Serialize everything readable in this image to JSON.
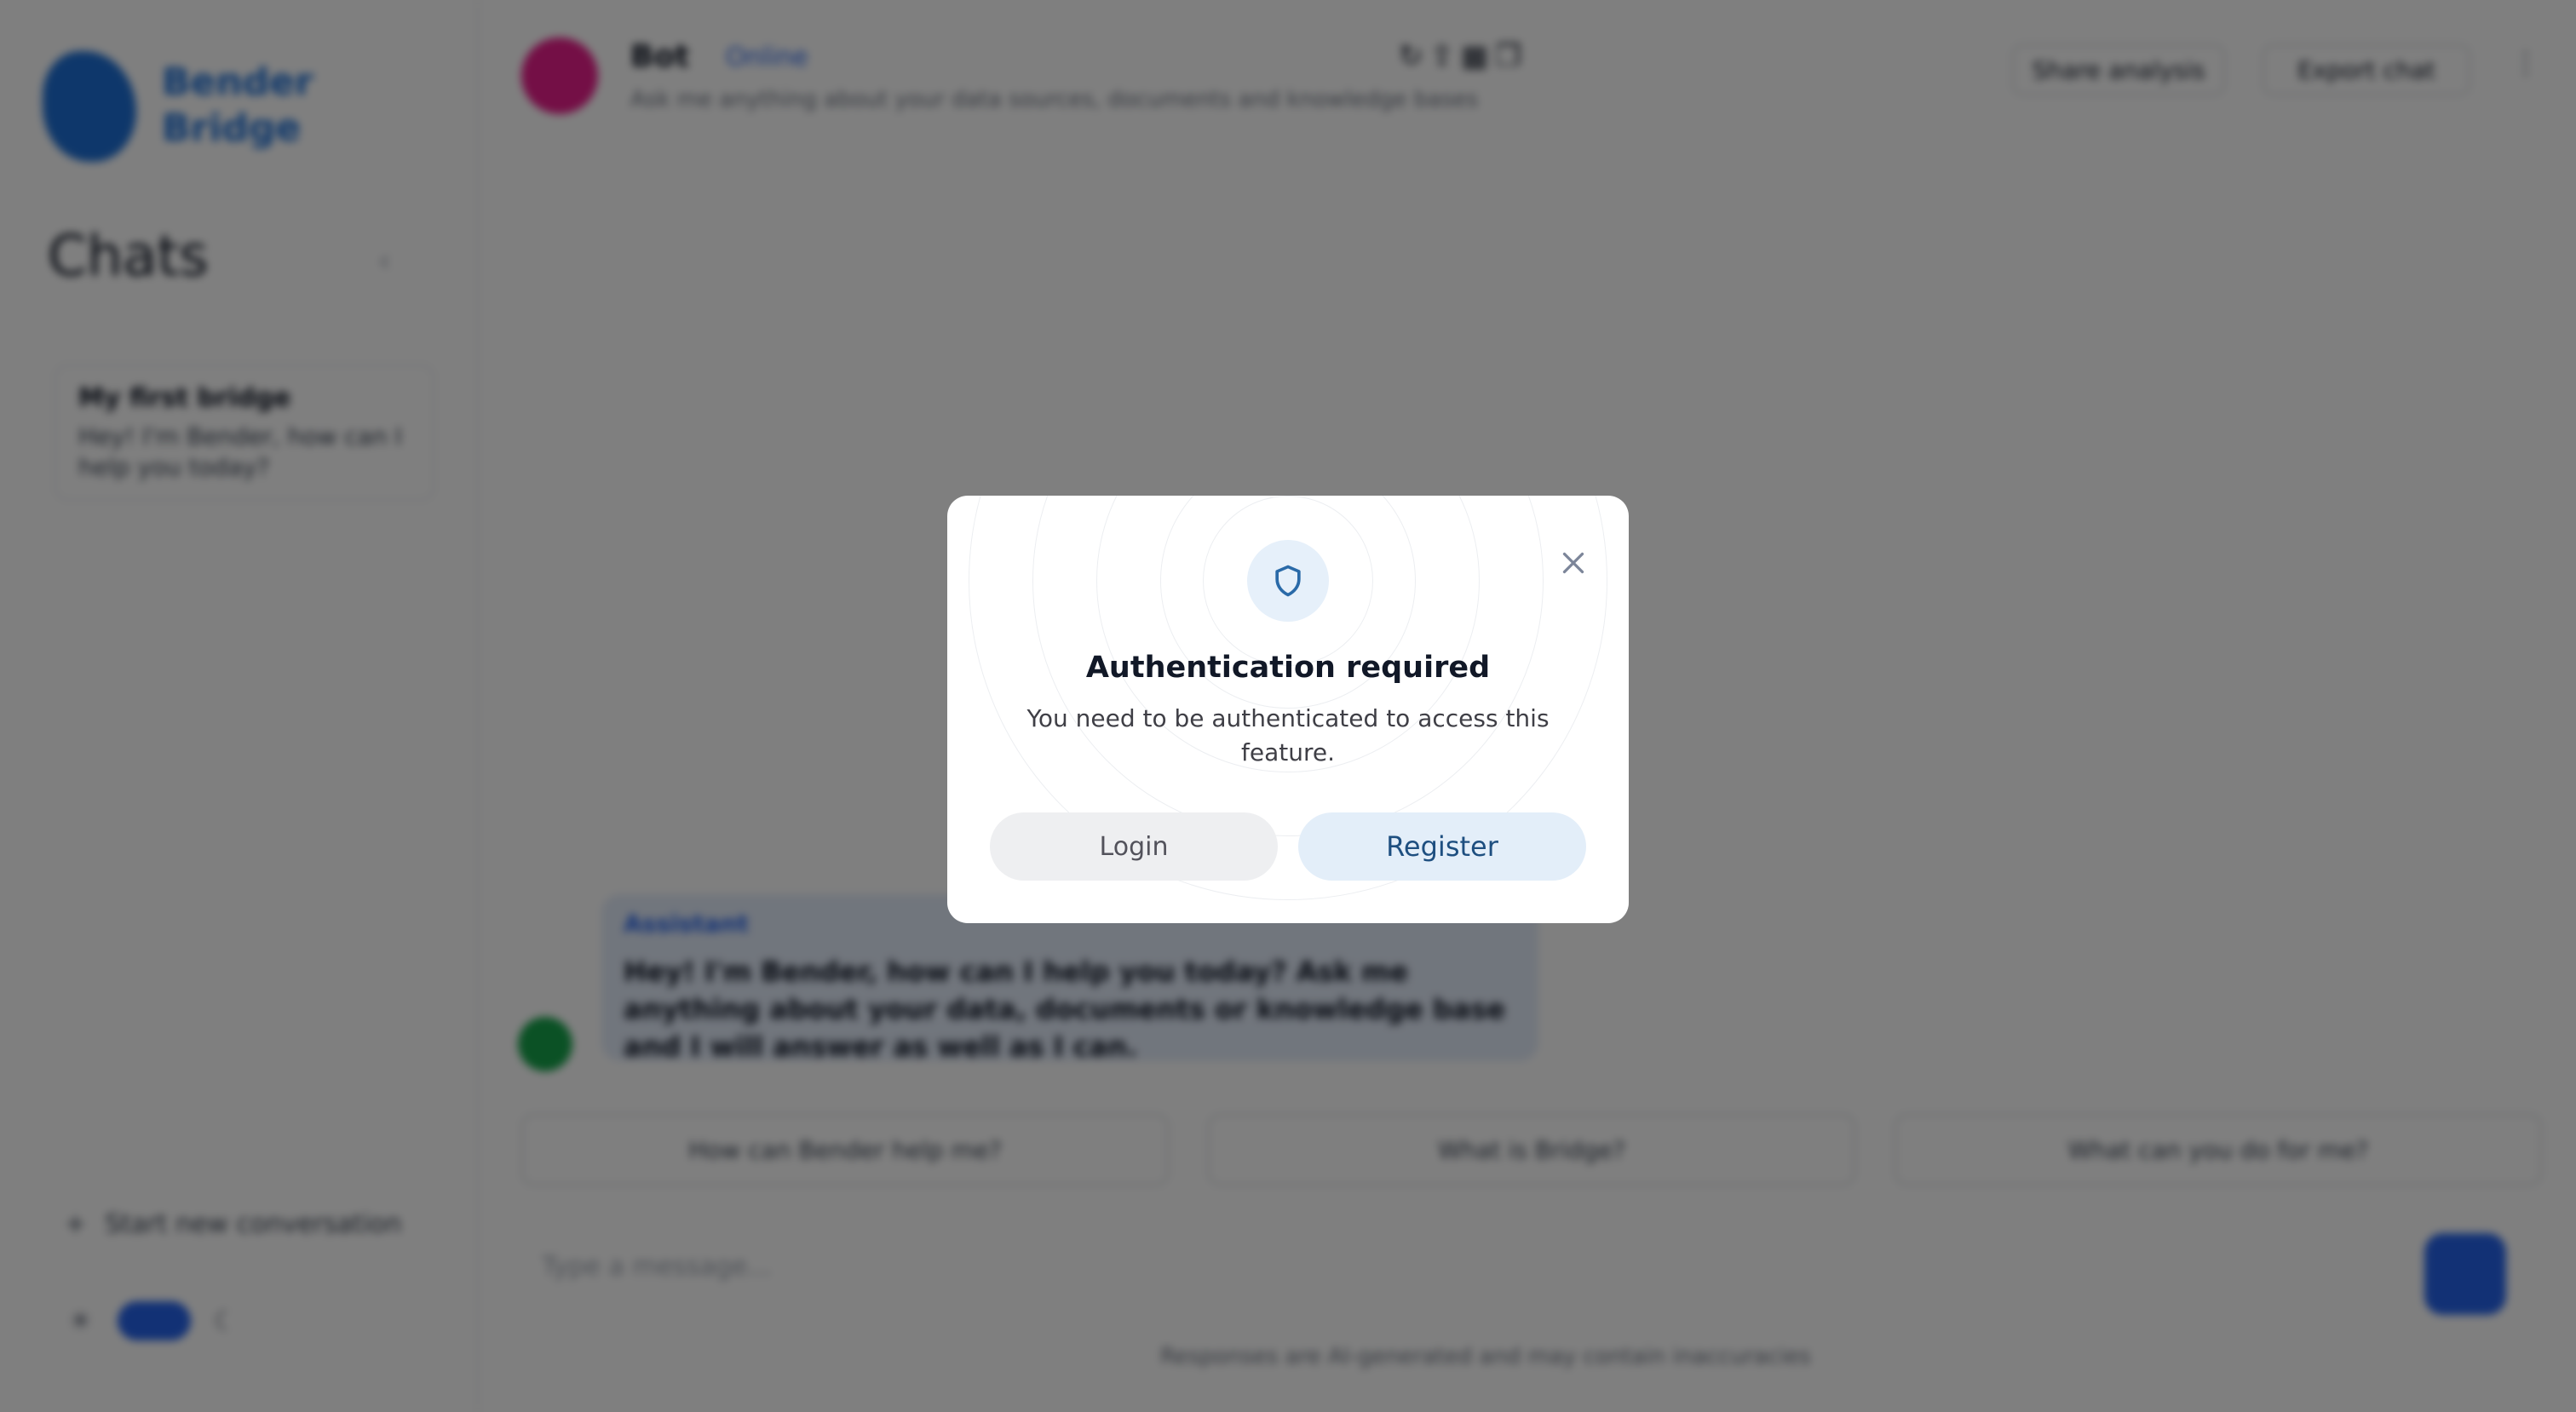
{
  "sidebar": {
    "logo_text_line1": "Bender",
    "logo_text_line2": "Bridge",
    "title": "Chats",
    "collapse_icon": "chevron-left-icon",
    "chats": [
      {
        "title": "My first bridge",
        "preview": "Hey! I'm Bender, how can I help you today?"
      }
    ],
    "action_label": "Start new conversation",
    "theme_toggle": {
      "light_icon": "sun-icon",
      "dark_icon": "moon-icon"
    }
  },
  "header": {
    "bot_name": "Bot",
    "bot_status": "Online",
    "bot_description": "Ask me anything about your data sources, documents and knowledge bases",
    "share_label": "Share analysis",
    "export_label": "Export chat",
    "more_icon": "more-icon"
  },
  "conversation": {
    "message_label": "Assistant",
    "message_text": "Hey! I'm Bender, how can I help you today? Ask me anything about your data, documents or knowledge base and I will answer as well as I can."
  },
  "suggestions": [
    "How can Bender help me?",
    "What is Bridge?",
    "What can you do for me?"
  ],
  "composer": {
    "placeholder": "Type a message..."
  },
  "footer_note": "Responses are AI-generated and may contain inaccuracies",
  "modal": {
    "icon": "shield-icon",
    "title": "Authentication required",
    "description": "You need to be authenticated to access this feature.",
    "login_label": "Login",
    "register_label": "Register",
    "close_icon": "close-icon"
  },
  "colors": {
    "accent": "#2563eb",
    "overlay": "rgba(0,0,0,0.5)",
    "register_bg": "#e3eef9",
    "register_text": "#1e4f80",
    "login_bg": "#eeeff1"
  }
}
